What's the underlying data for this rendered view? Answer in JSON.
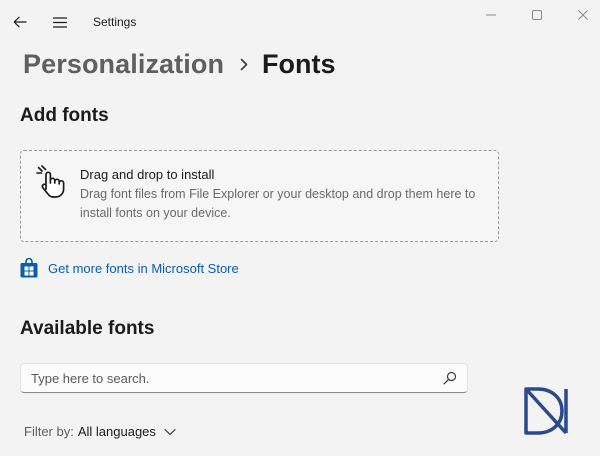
{
  "window": {
    "title": "Settings",
    "back_icon": "back-arrow-icon",
    "menu_icon": "hamburger-menu-icon",
    "controls": [
      "minimize-icon",
      "maximize-icon",
      "close-icon"
    ]
  },
  "breadcrumb": {
    "parent": "Personalization",
    "separator_icon": "chevron-right-icon",
    "current": "Fonts"
  },
  "add_fonts": {
    "title": "Add fonts",
    "dropzone": {
      "icon": "hand-pointer-icon",
      "heading": "Drag and drop to install",
      "description": "Drag font files from File Explorer or your desktop and drop them here to install fonts on your device."
    },
    "store_link": {
      "icon": "microsoft-store-icon",
      "label": "Get more fonts in Microsoft Store",
      "color": "#0a5dad"
    }
  },
  "available_fonts": {
    "title": "Available fonts",
    "search": {
      "placeholder": "Type here to search.",
      "value": "",
      "icon": "search-icon"
    },
    "filter": {
      "label": "Filter by:",
      "value": "All languages",
      "icon": "chevron-down-icon"
    }
  },
  "watermark": {
    "icon": "brand-logo-icon",
    "color": "#2a4a8c"
  }
}
